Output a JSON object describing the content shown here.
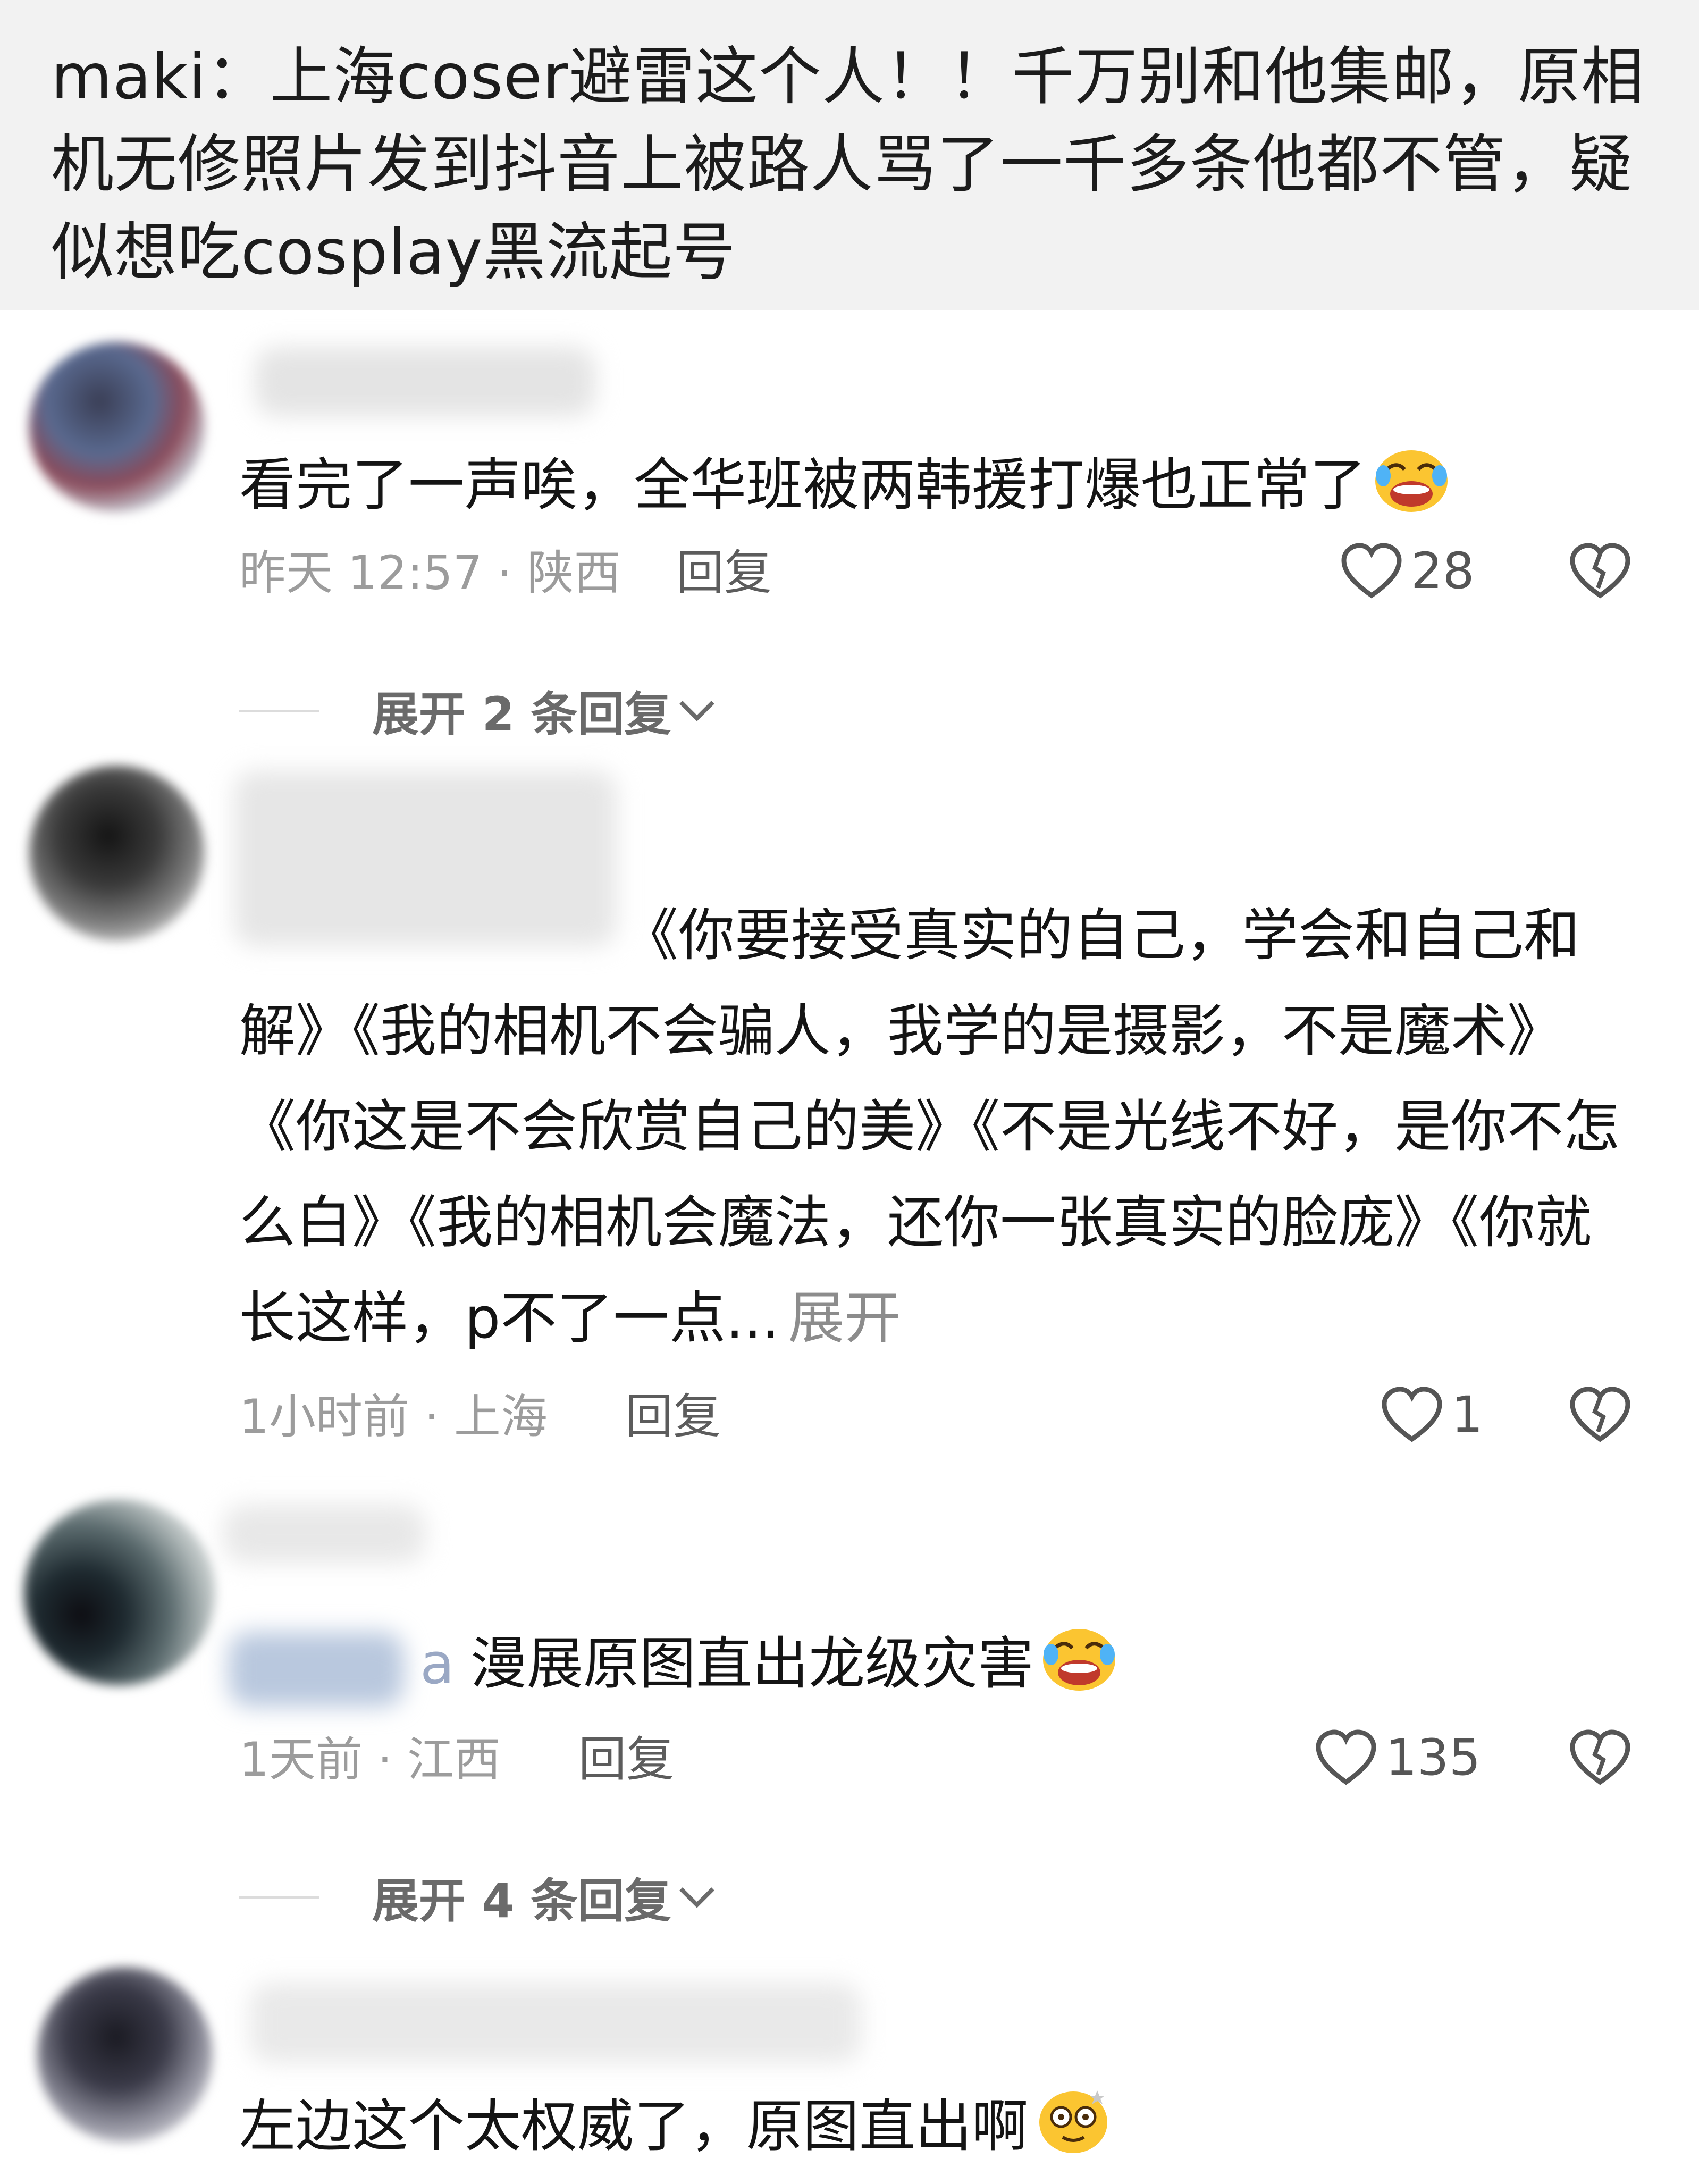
{
  "header": {
    "text": "maki：上海coser避雷这个人！！千万别和他集邮，原相机无修照片发到抖音上被路人骂了一千多条他都不管，疑似想吃cosplay黑流起号"
  },
  "comments": [
    {
      "text": "看完了一声唉，全华班被两韩援打爆也正常了",
      "emoji": "rolling-laughing-emoji",
      "meta": "昨天 12:57 · 陕西",
      "reply_label": "回复",
      "likes": "28",
      "expand_label": "展开 2 条回复"
    },
    {
      "text": "《你要接受真实的自己，学会和自己和解》《我的相机不会骗人，我学的是摄影，不是魔术》《你这是不会欣赏自己的美》《不是光线不好，是你不怎么白》《我的相机会魔法，还你一张真实的脸庞》《你就长这样，p不了一点...",
      "more_label": "展开",
      "meta": "1小时前 · 上海",
      "reply_label": "回复",
      "likes": "1"
    },
    {
      "name_tail": "a",
      "text": "漫展原图直出龙级灾害",
      "emoji": "rolling-laughing-emoji",
      "meta": "1天前 · 江西",
      "reply_label": "回复",
      "likes": "135",
      "expand_label": "展开 4 条回复"
    },
    {
      "text": "左边这个太权威了，原图直出啊",
      "emoji": "dizzy-face-emoji"
    }
  ],
  "icons": {
    "like": "heart-outline-icon",
    "dislike": "broken-heart-icon",
    "expand": "chevron-down-icon"
  },
  "colors": {
    "header_bg": "#f2f2f2",
    "text": "#141414",
    "meta": "#9c9c9c"
  }
}
